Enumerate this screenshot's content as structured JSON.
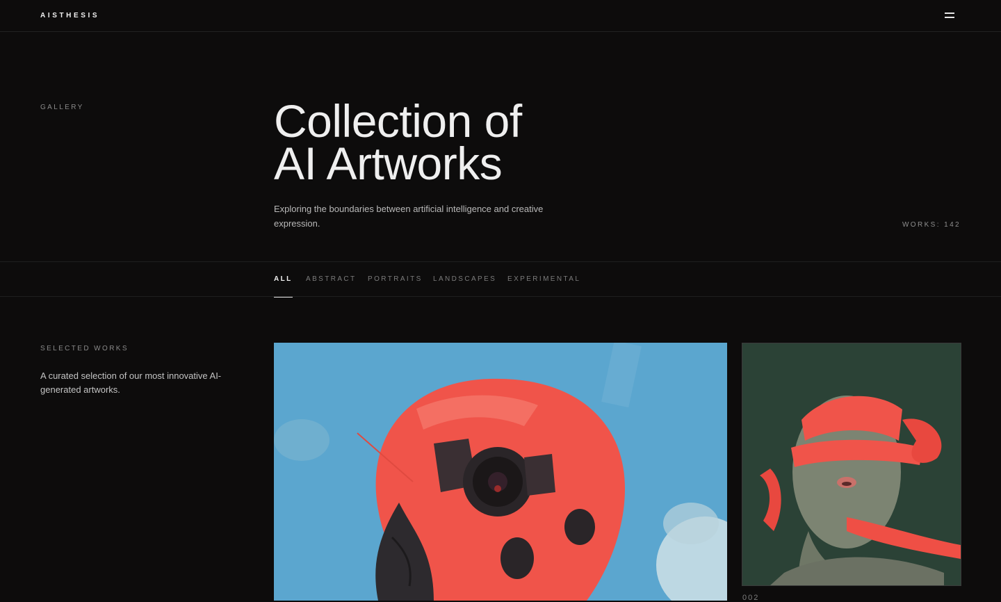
{
  "header": {
    "logo": "AISTHESIS",
    "menu_icon": "menu-icon"
  },
  "hero": {
    "eyebrow": "GALLERY",
    "title_line1": "Collection of",
    "title_line2": "AI Artworks",
    "subtitle": "Exploring the boundaries between artificial intelligence and creative expression.",
    "works_count": "WORKS: 142"
  },
  "filters": [
    {
      "label": "ALL",
      "active": true
    },
    {
      "label": "ABSTRACT",
      "active": false
    },
    {
      "label": "PORTRAITS",
      "active": false
    },
    {
      "label": "LANDSCAPES",
      "active": false
    },
    {
      "label": "EXPERIMENTAL",
      "active": false
    }
  ],
  "selected": {
    "eyebrow": "SELECTED WORKS",
    "description": "A curated selection of our most innovative AI-generated artworks."
  },
  "artworks": [
    {
      "subject": "red robotic skull against blue sky",
      "number": ""
    },
    {
      "subject": "face wrapped in red ribbon",
      "number": "002"
    }
  ],
  "colors": {
    "background": "#0d0c0c",
    "text": "#ececec",
    "muted": "#8a8a8a",
    "art_red": "#f0544a",
    "art_blue": "#5ba6cf",
    "art_green": "#2b4236"
  }
}
